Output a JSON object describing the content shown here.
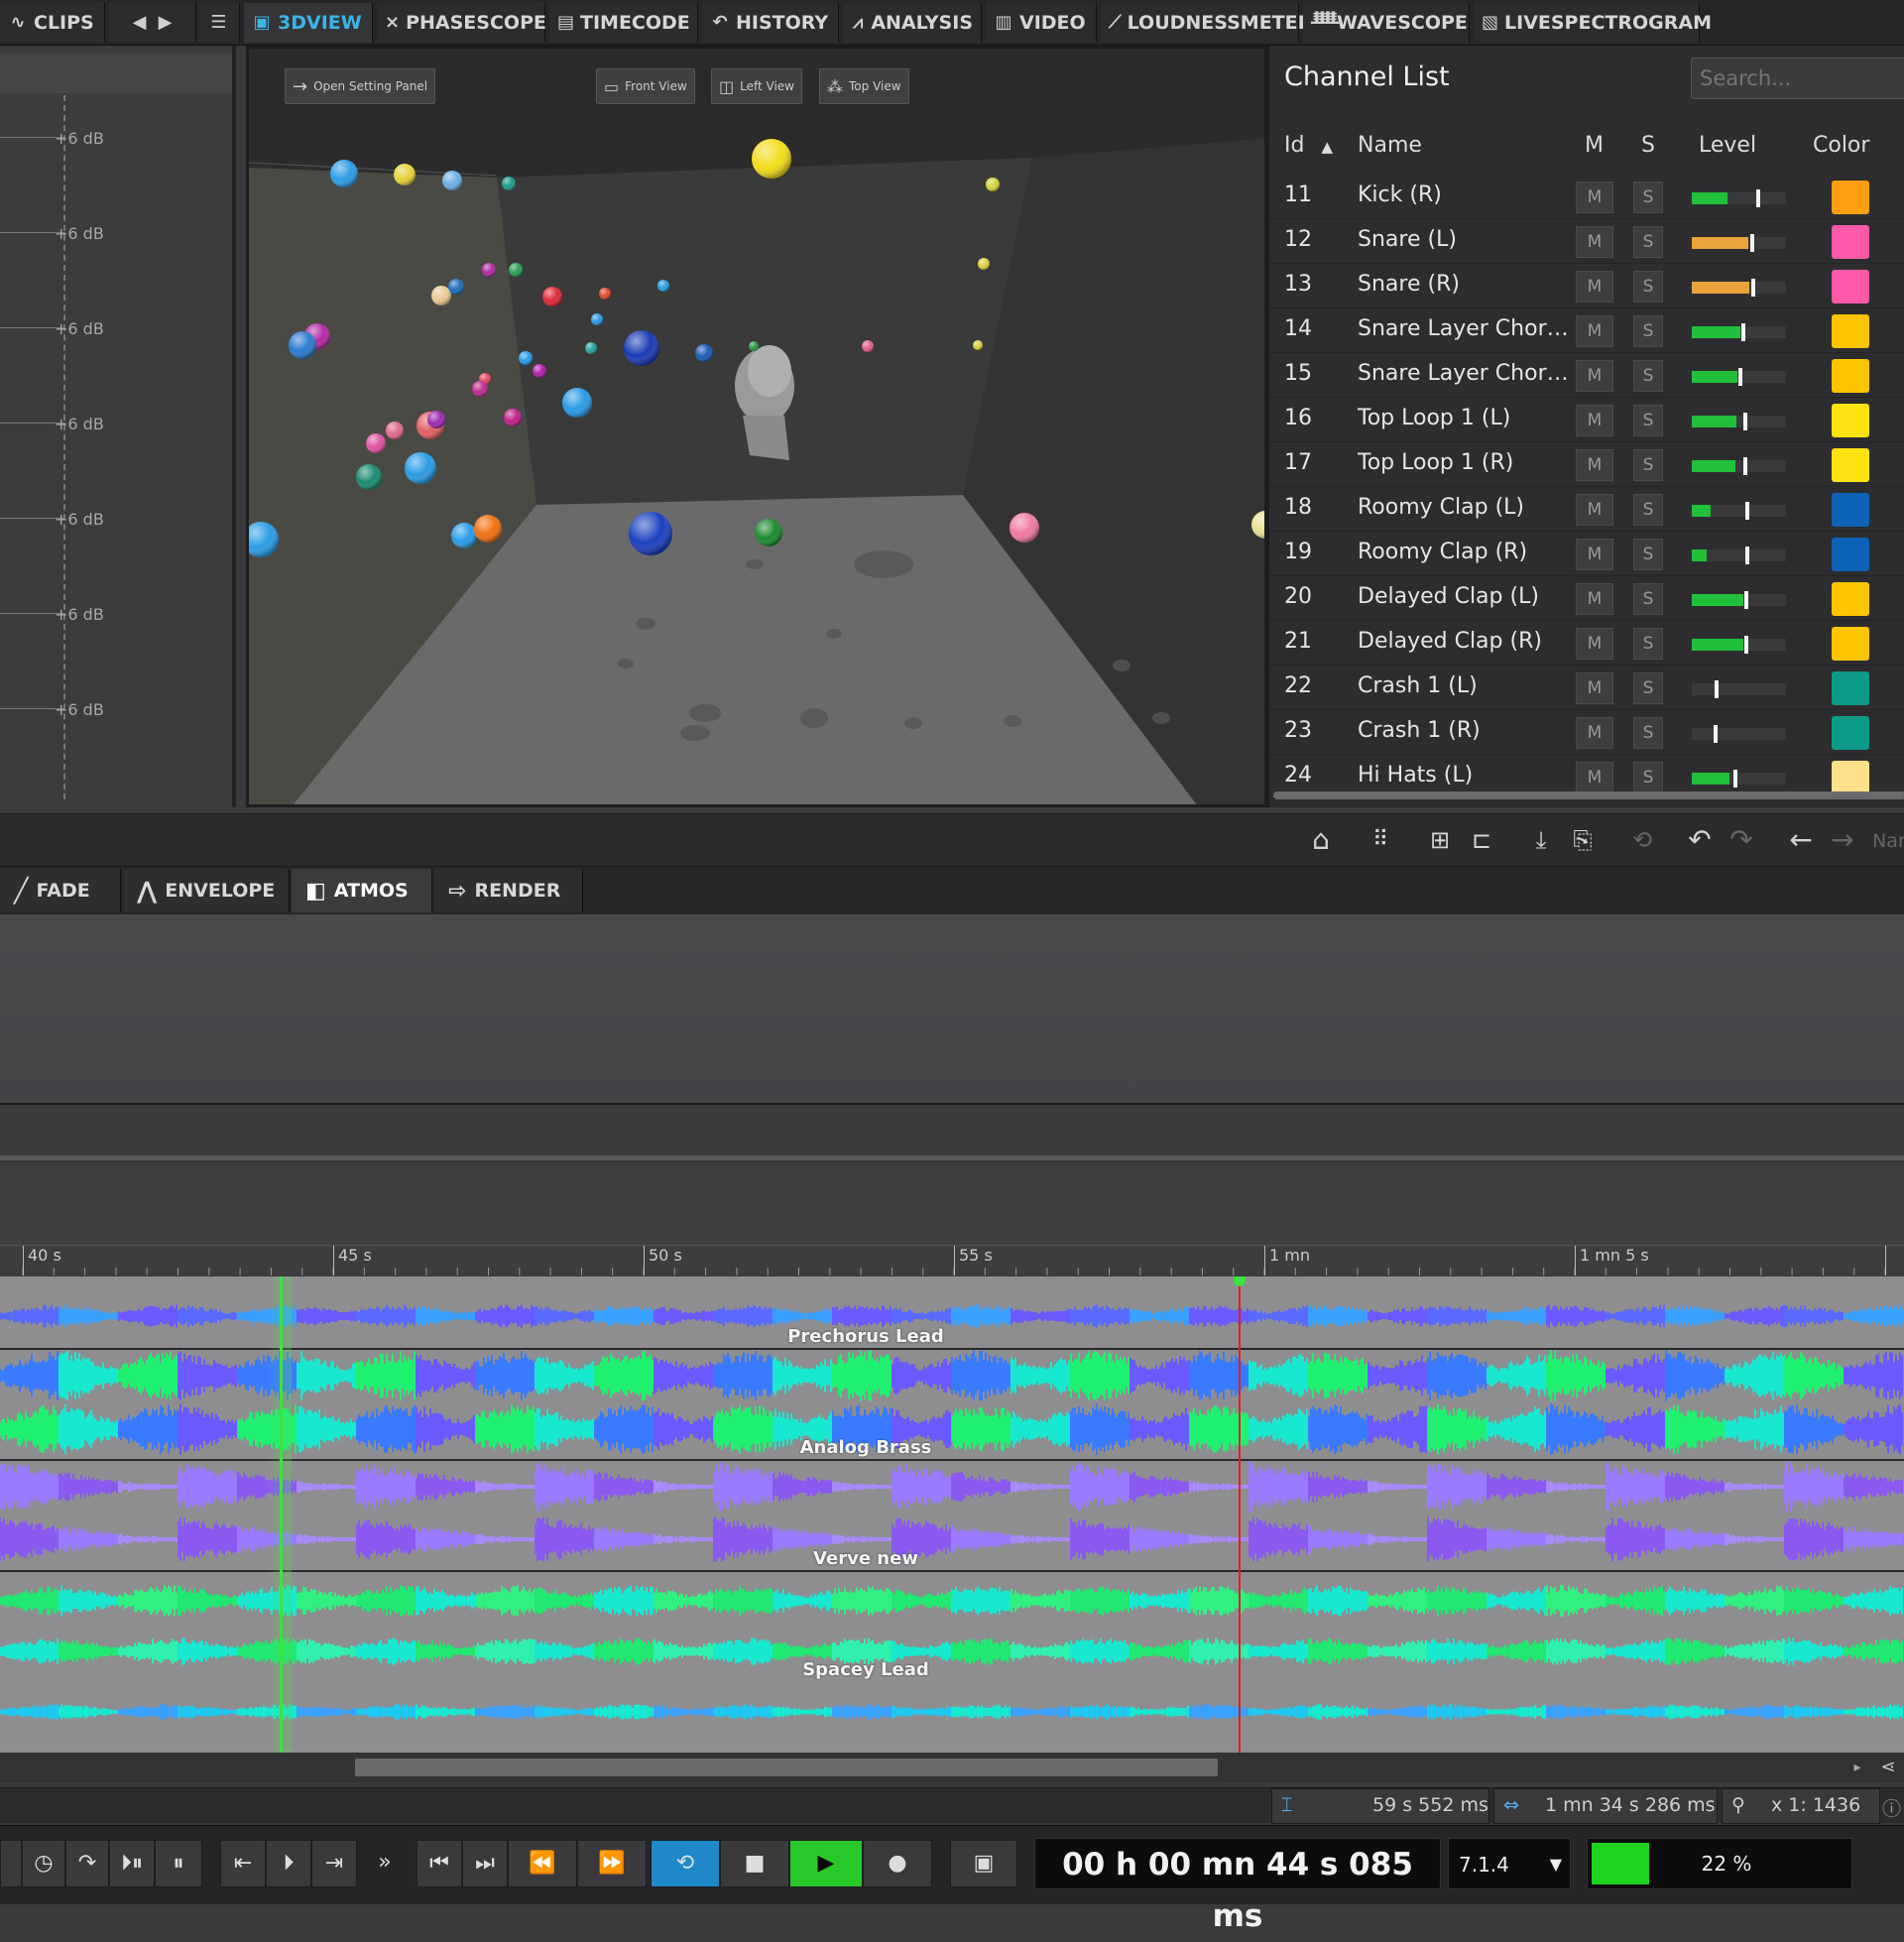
{
  "top_tabs": [
    {
      "label": "CLIPS",
      "icon": "waveform-icon"
    },
    {
      "label": "3DVIEW",
      "icon": "cube-icon",
      "active": true
    },
    {
      "label": "PHASESCOPE",
      "icon": "phasescope-icon"
    },
    {
      "label": "TIMECODE",
      "icon": "timecode-icon"
    },
    {
      "label": "HISTORY",
      "icon": "undo-history-icon"
    },
    {
      "label": "ANALYSIS",
      "icon": "analysis-icon"
    },
    {
      "label": "VIDEO",
      "icon": "film-icon"
    },
    {
      "label": "LOUDNESSMETER",
      "icon": "meter-icon"
    },
    {
      "label": "WAVESCOPE",
      "icon": "wavescope-icon"
    },
    {
      "label": "LIVESPECTROGRAM",
      "icon": "spectrogram-icon"
    }
  ],
  "meter_panel": {
    "db_label": "+6 dB"
  },
  "view3d": {
    "open_settings": "Open Setting Panel",
    "front_view": "Front View",
    "left_view": "Left View",
    "top_view": "Top View"
  },
  "channel_list": {
    "title": "Channel List",
    "search_placeholder": "Search...",
    "headers": {
      "id": "Id",
      "name": "Name",
      "mute": "M",
      "solo": "S",
      "level": "Level",
      "color": "Color"
    },
    "rows": [
      {
        "id": "11",
        "name": "Kick (R)",
        "level": 0.38,
        "peak": 0.68,
        "level_color": "#22c03a",
        "color": "#ff9f10"
      },
      {
        "id": "12",
        "name": "Snare (L)",
        "level": 0.6,
        "peak": 0.62,
        "level_color": "#e8a33a",
        "color": "#ff5aa8"
      },
      {
        "id": "13",
        "name": "Snare (R)",
        "level": 0.61,
        "peak": 0.63,
        "level_color": "#e8a33a",
        "color": "#ff5aa8"
      },
      {
        "id": "14",
        "name": "Snare Layer Chorus (L)",
        "level": 0.52,
        "peak": 0.53,
        "level_color": "#22c03a",
        "color": "#ffc400"
      },
      {
        "id": "15",
        "name": "Snare Layer Chorus (R)",
        "level": 0.48,
        "peak": 0.49,
        "level_color": "#22c03a",
        "color": "#ffc400"
      },
      {
        "id": "16",
        "name": "Top Loop 1 (L)",
        "level": 0.47,
        "peak": 0.55,
        "level_color": "#22c03a",
        "color": "#ffe310"
      },
      {
        "id": "17",
        "name": "Top Loop 1 (R)",
        "level": 0.46,
        "peak": 0.55,
        "level_color": "#22c03a",
        "color": "#ffe310"
      },
      {
        "id": "18",
        "name": "Roomy Clap (L)",
        "level": 0.2,
        "peak": 0.57,
        "level_color": "#22c03a",
        "color": "#0d62b8"
      },
      {
        "id": "19",
        "name": "Roomy Clap (R)",
        "level": 0.16,
        "peak": 0.57,
        "level_color": "#22c03a",
        "color": "#0d62b8"
      },
      {
        "id": "20",
        "name": "Delayed Clap (L)",
        "level": 0.55,
        "peak": 0.56,
        "level_color": "#22c03a",
        "color": "#ffc400"
      },
      {
        "id": "21",
        "name": "Delayed Clap (R)",
        "level": 0.55,
        "peak": 0.56,
        "level_color": "#22c03a",
        "color": "#ffc400"
      },
      {
        "id": "22",
        "name": "Crash 1 (L)",
        "level": 0.0,
        "peak": 0.24,
        "level_color": "#22c03a",
        "color": "#0e9a88"
      },
      {
        "id": "23",
        "name": "Crash 1 (R)",
        "level": 0.0,
        "peak": 0.23,
        "level_color": "#22c03a",
        "color": "#0e9a88"
      },
      {
        "id": "24",
        "name": "Hi Hats (L)",
        "level": 0.4,
        "peak": 0.44,
        "level_color": "#22c03a",
        "color": "#ffe08a"
      }
    ]
  },
  "lower_tabs": [
    {
      "label": "FADE",
      "icon": "fade-icon"
    },
    {
      "label": "ENVELOPE",
      "icon": "envelope-icon"
    },
    {
      "label": "ATMOS",
      "icon": "dolby-icon",
      "active": true
    },
    {
      "label": "RENDER",
      "icon": "render-icon"
    }
  ],
  "toolbar": {
    "search_partial": "Nar"
  },
  "ruler": {
    "labels": [
      "40 s",
      "45 s",
      "50 s",
      "55 s",
      "1 mn",
      "1 mn 5 s"
    ]
  },
  "tracks": [
    {
      "name": "Prechorus Lead",
      "style": "blue"
    },
    {
      "name": "Analog Brass",
      "style": "cyan"
    },
    {
      "name": "Verve new",
      "style": "purple"
    },
    {
      "name": "Spacey Lead",
      "style": "green"
    }
  ],
  "info_bar": {
    "cursor_pos": "59 s 552 ms",
    "selection_length": "1 mn 34 s 286 ms",
    "zoom": "x 1: 1436"
  },
  "transport": {
    "time": "00 h 00 mn 44 s 085 ms",
    "channel_format": "7.1.4",
    "cpu": "22 %"
  }
}
